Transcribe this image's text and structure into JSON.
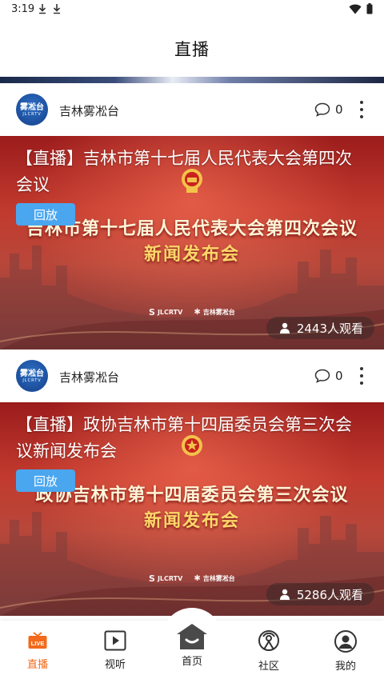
{
  "status": {
    "time": "3:19"
  },
  "header": {
    "title": "直播"
  },
  "cards": [
    {
      "channel": "吉林雾凇台",
      "avatar_text": "雾凇台",
      "avatar_sub": "JLCRTV",
      "comments": "0",
      "title": "【直播】吉林市第十七届人民代表大会第四次会议",
      "poster_title": "吉林市第十七届人民代表大会第四次会议",
      "poster_subtitle": "新闻发布会",
      "replay_label": "回放",
      "logo_a": "JLCRTV",
      "logo_b": "吉林雾凇台",
      "views": "2443人观看"
    },
    {
      "channel": "吉林雾凇台",
      "avatar_text": "雾凇台",
      "avatar_sub": "JLCRTV",
      "comments": "0",
      "title": "【直播】政协吉林市第十四届委员会第三次会议新闻发布会",
      "poster_title": "政协吉林市第十四届委员会第三次会议",
      "poster_subtitle": "新闻发布会",
      "replay_label": "回放",
      "logo_a": "JLCRTV",
      "logo_b": "吉林雾凇台",
      "views": "5286人观看"
    }
  ],
  "nav": {
    "items": [
      {
        "label": "直播",
        "icon": "live-tv-icon",
        "active": true
      },
      {
        "label": "视听",
        "icon": "play-icon",
        "active": false
      },
      {
        "label": "首页",
        "icon": "home-icon",
        "active": false
      },
      {
        "label": "社区",
        "icon": "community-icon",
        "active": false
      },
      {
        "label": "我的",
        "icon": "profile-icon",
        "active": false
      }
    ]
  },
  "colors": {
    "accent": "#f26a1b",
    "replay": "#4aa6ef",
    "poster_red": "#c23a2e"
  }
}
